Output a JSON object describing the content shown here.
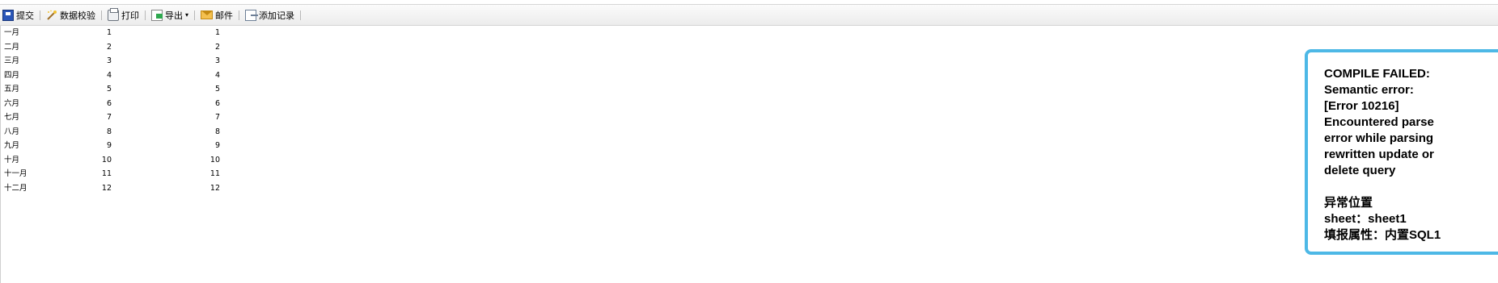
{
  "toolbar": {
    "items": [
      {
        "label": "提交",
        "icon": "submit-icon"
      },
      {
        "label": "数据校验",
        "icon": "validate-icon"
      },
      {
        "label": "打印",
        "icon": "print-icon"
      },
      {
        "label": "导出",
        "icon": "export-icon",
        "dropdown": "▾"
      },
      {
        "label": "邮件",
        "icon": "mail-icon"
      },
      {
        "label": "添加记录",
        "icon": "add-record-icon"
      }
    ]
  },
  "sheet": {
    "rows": [
      {
        "month": "一月",
        "v1": "1",
        "v2": "1"
      },
      {
        "month": "二月",
        "v1": "2",
        "v2": "2"
      },
      {
        "month": "三月",
        "v1": "3",
        "v2": "3"
      },
      {
        "month": "四月",
        "v1": "4",
        "v2": "4"
      },
      {
        "month": "五月",
        "v1": "5",
        "v2": "5"
      },
      {
        "month": "六月",
        "v1": "6",
        "v2": "6"
      },
      {
        "month": "七月",
        "v1": "7",
        "v2": "7"
      },
      {
        "month": "八月",
        "v1": "8",
        "v2": "8"
      },
      {
        "month": "九月",
        "v1": "9",
        "v2": "9"
      },
      {
        "month": "十月",
        "v1": "10",
        "v2": "10"
      },
      {
        "month": "十一月",
        "v1": "11",
        "v2": "11"
      },
      {
        "month": "十二月",
        "v1": "12",
        "v2": "12"
      }
    ]
  },
  "error": {
    "lines": [
      "COMPILE FAILED:",
      "Semantic error:",
      "[Error 10216]",
      "Encountered parse",
      "error while parsing",
      "rewritten update or",
      "delete query"
    ],
    "location_title": "异常位置",
    "sheet_line": "sheet：sheet1",
    "attr_line": "填报属性：内置SQL1"
  },
  "colors": {
    "error_border": "#4db8e6",
    "toolbar_bg": "#ececec"
  }
}
